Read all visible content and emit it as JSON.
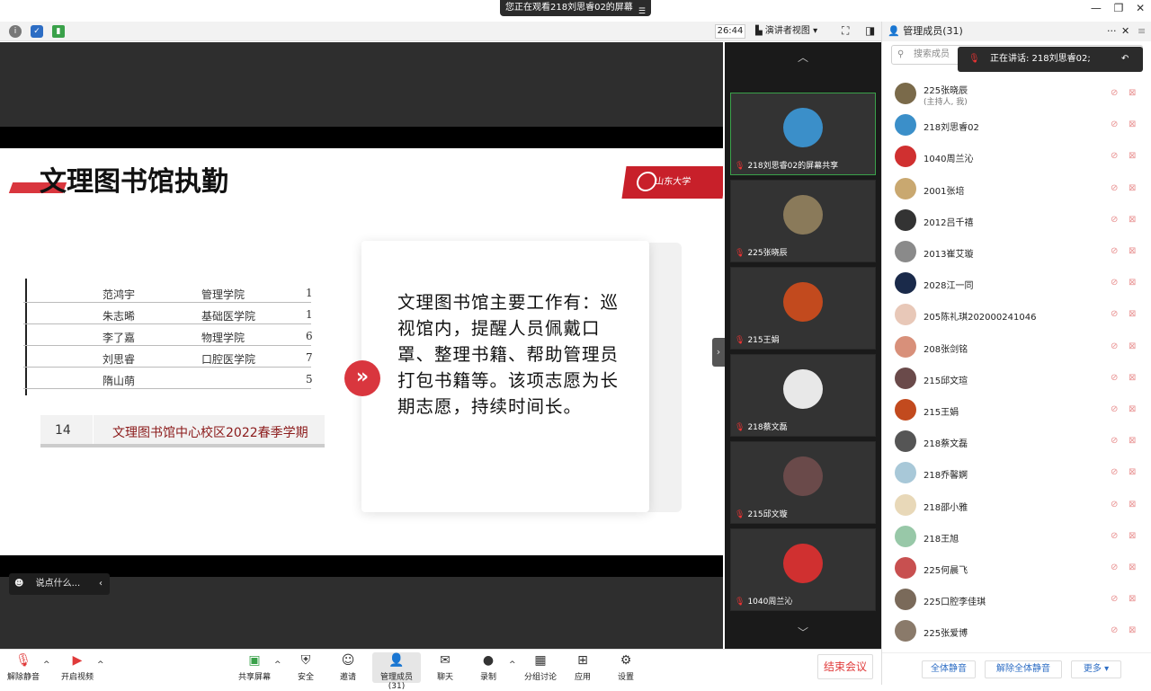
{
  "window": {
    "banner": "您正在观看218刘思睿02的屏幕",
    "controls": [
      "—",
      "❐",
      "✕"
    ]
  },
  "infobar": {
    "timer": "26:44",
    "view_mode": "演讲者视图"
  },
  "slide": {
    "title": "文理图书馆执勤",
    "logo_text": "山东大学",
    "scan_rows": [
      {
        "name": "范鸿宇",
        "college": "管理学院",
        "num": "1"
      },
      {
        "name": "朱志晞",
        "college": "基础医学院",
        "num": "1"
      },
      {
        "name": "李了嘉",
        "college": "物理学院",
        "num": "6"
      },
      {
        "name": "刘思睿",
        "college": "口腔医学院",
        "num": "7"
      },
      {
        "name": "隋山萌",
        "college": "",
        "num": "5"
      }
    ],
    "caption_num": "14",
    "caption_text": "文理图书馆中心校区2022春季学期",
    "card_text": "文理图书馆主要工作有：巡视馆内，提醒人员佩戴口罩、整理书籍、帮助管理员打包书籍等。该项志愿为长期志愿，持续时间长。"
  },
  "chat_input": "说点什么...",
  "gallery": {
    "tiles": [
      {
        "name": "218刘思睿02的屏幕共享",
        "color": "#3b8fc9",
        "active": true
      },
      {
        "name": "225张晓辰",
        "color": "#8a7a5a",
        "active": false
      },
      {
        "name": "215王娟",
        "color": "#c24a1e",
        "active": false
      },
      {
        "name": "218蔡文磊",
        "color": "#e8e8e8",
        "active": false
      },
      {
        "name": "215邱文璇",
        "color": "#6a4a4a",
        "active": false
      },
      {
        "name": "1040周兰沁",
        "color": "#d03030",
        "active": false
      }
    ]
  },
  "toolbar": {
    "unmute": "解除静音",
    "start_video": "开启视频",
    "share_screen": "共享屏幕",
    "security": "安全",
    "invite": "邀请",
    "participants": "管理成员(31)",
    "chat": "聊天",
    "record": "录制",
    "breakout": "分组讨论",
    "apps": "应用",
    "settings": "设置",
    "end_meeting": "结束会议"
  },
  "panel": {
    "title": "管理成员(31)",
    "search_placeholder": "搜索成员",
    "speaking": "正在讲话: 218刘思睿02;",
    "members": [
      {
        "name": "225张晓辰",
        "sub": "(主持人, 我)",
        "color": "#7a6a4a"
      },
      {
        "name": "218刘思睿02",
        "sub": "",
        "color": "#3b8fc9"
      },
      {
        "name": "1040周兰沁",
        "sub": "",
        "color": "#d03030"
      },
      {
        "name": "2001张培",
        "sub": "",
        "color": "#c9a870"
      },
      {
        "name": "2012吕千禧",
        "sub": "",
        "color": "#333333"
      },
      {
        "name": "2013崔艾璇",
        "sub": "",
        "color": "#8a8a8a"
      },
      {
        "name": "2028江一同",
        "sub": "",
        "color": "#1a2a4a"
      },
      {
        "name": "205陈礼琪202000241046",
        "sub": "",
        "color": "#e8c8b8"
      },
      {
        "name": "208张剑铭",
        "sub": "",
        "color": "#d8907a"
      },
      {
        "name": "215邱文瑄",
        "sub": "",
        "color": "#6a4a4a"
      },
      {
        "name": "215王娟",
        "sub": "",
        "color": "#c24a1e"
      },
      {
        "name": "218蔡文磊",
        "sub": "",
        "color": "#555555"
      },
      {
        "name": "218乔馨婀",
        "sub": "",
        "color": "#a8c8d8"
      },
      {
        "name": "218邵小雅",
        "sub": "",
        "color": "#e8d8b8"
      },
      {
        "name": "218王旭",
        "sub": "",
        "color": "#98c8a8"
      },
      {
        "name": "225何晨飞",
        "sub": "",
        "color": "#c85050"
      },
      {
        "name": "225口腔李佳琪",
        "sub": "",
        "color": "#7a6a5a"
      },
      {
        "name": "225张爱博",
        "sub": "",
        "color": "#8a7a6a"
      }
    ],
    "mute_all": "全体静音",
    "unmute_all": "解除全体静音",
    "more": "更多"
  }
}
